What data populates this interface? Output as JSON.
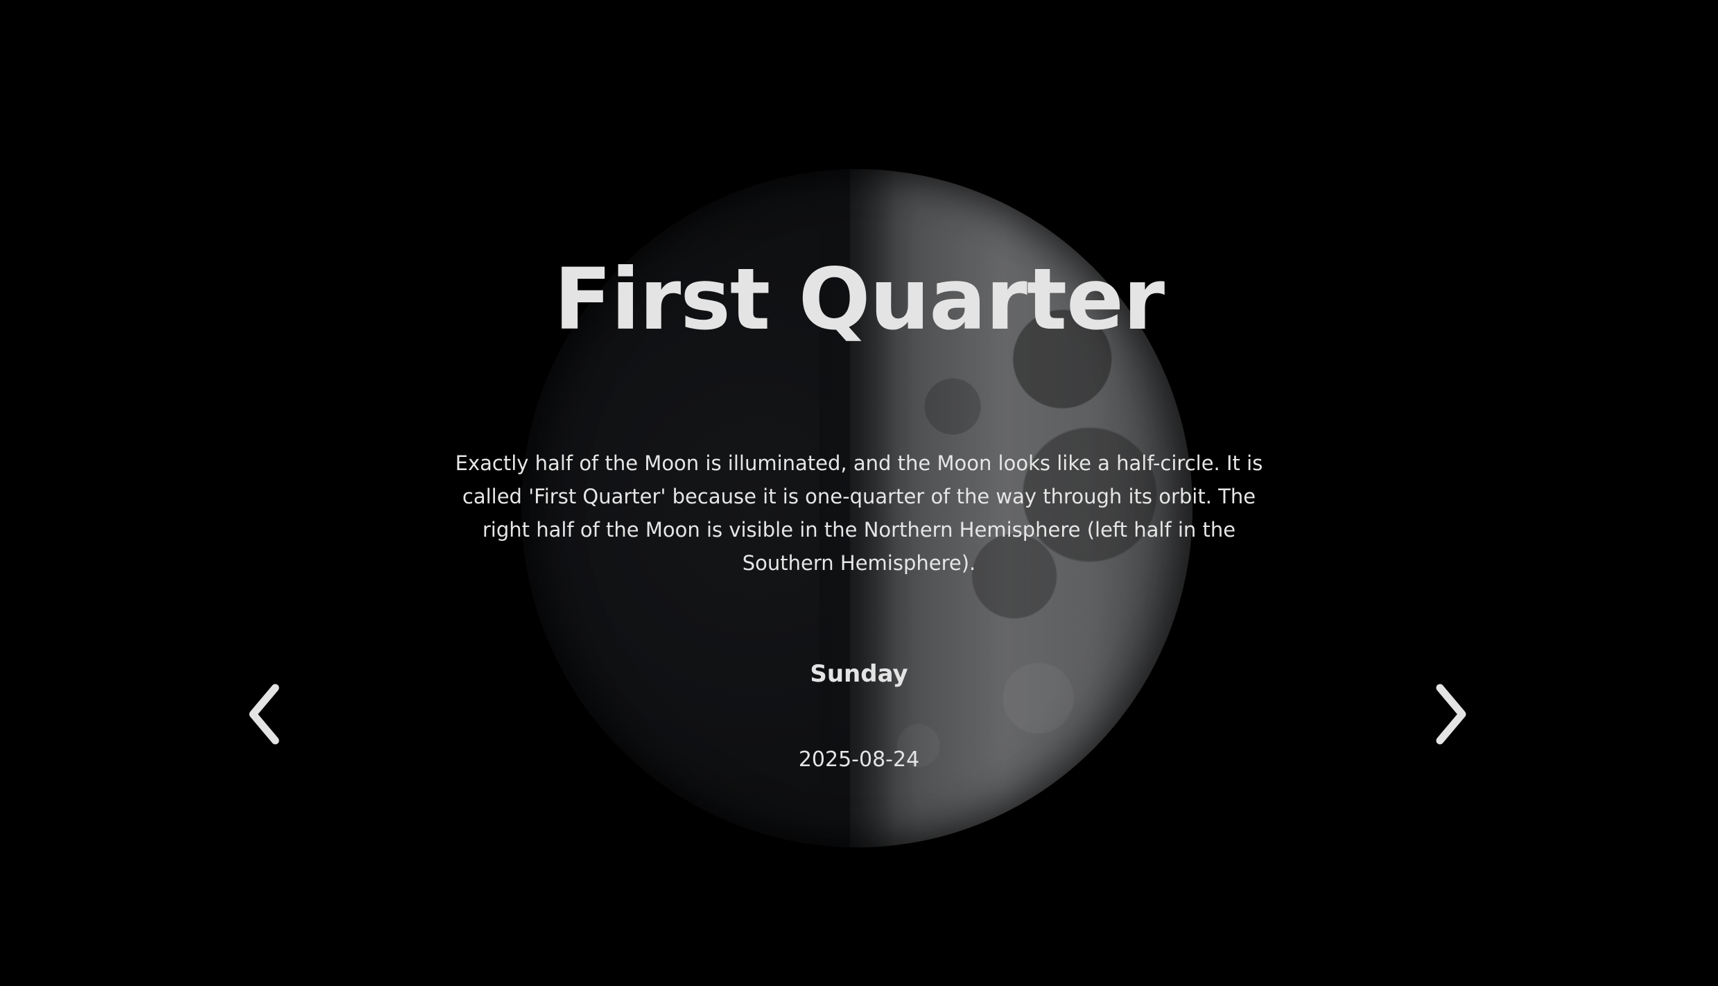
{
  "phase": {
    "name": "First Quarter",
    "description": "Exactly half of the Moon is illuminated, and the Moon looks like a half-circle. It is called 'First Quarter' because it is one-quarter of the way through its orbit. The right half of the Moon is visible in the Northern Hemisphere (left half in the Southern Hemisphere).",
    "weekday": "Sunday",
    "date": "2025-08-24"
  },
  "navigation": {
    "prev_icon": "chevron-left-icon",
    "next_icon": "chevron-right-icon"
  },
  "colors": {
    "background": "#000000",
    "text": "#e4e4e4"
  }
}
